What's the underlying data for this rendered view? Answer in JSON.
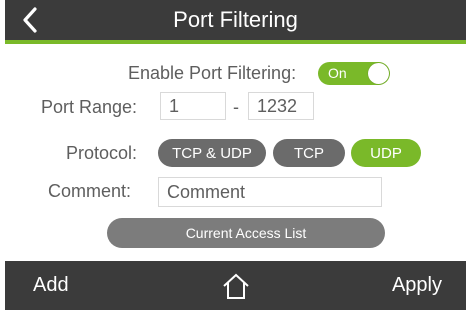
{
  "header": {
    "title": "Port Filtering",
    "back_icon": "chevron-left-icon"
  },
  "enable": {
    "label": "Enable Port Filtering:",
    "toggle_text": "On",
    "state": "on"
  },
  "port_range": {
    "label": "Port Range:",
    "start_value": "1",
    "separator": "-",
    "end_value": "1232"
  },
  "protocol": {
    "label": "Protocol:",
    "options": [
      "TCP & UDP",
      "TCP",
      "UDP"
    ],
    "selected": "UDP"
  },
  "comment": {
    "label": "Comment:",
    "value": "Comment"
  },
  "current_access_list": {
    "label": "Current Access List"
  },
  "footer": {
    "add_label": "Add",
    "home_icon": "home-icon",
    "apply_label": "Apply"
  },
  "colors": {
    "bar": "#3b3b3b",
    "accent_green": "#7ab929",
    "pill_gray": "#6b6b6b",
    "button_gray": "#7c7c7c",
    "text_gray": "#5e5e5e"
  }
}
